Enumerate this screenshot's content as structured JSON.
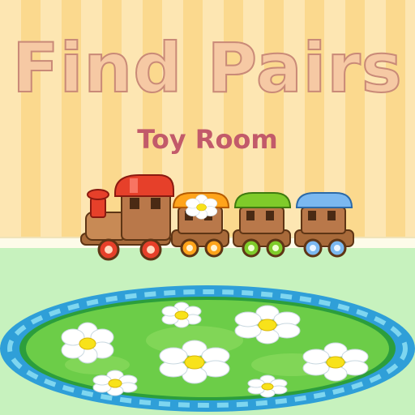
{
  "title": "Find Pairs",
  "subtitle": "Toy Room",
  "colors": {
    "title_fill": "#f6c9a4",
    "title_stroke": "#c98a78",
    "subtitle": "#c25a6a",
    "rug_green": "#6ccd48",
    "rug_border": "#3aa7d8",
    "wagon_roofs": [
      "#ffa41b",
      "#7fcb2a",
      "#7bb8f0"
    ],
    "engine_roof": "#e6402a"
  },
  "icons": {
    "train": "toy-train-icon",
    "flower": "daisy-icon"
  }
}
